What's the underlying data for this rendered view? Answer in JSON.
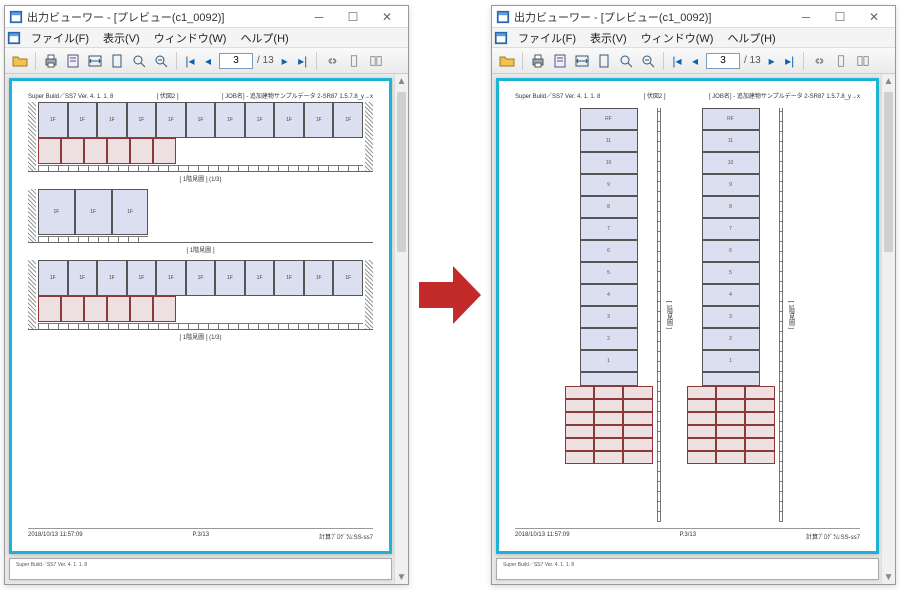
{
  "app": {
    "title_prefix": "出力ビューワー - ",
    "doc_name": "[プレビュー(c1_0092)]"
  },
  "menu": {
    "file": "ファイル(F)",
    "view": "表示(V)",
    "window": "ウィンドウ(W)",
    "help": "ヘルプ(H)"
  },
  "toolbar": {
    "page_current": "3",
    "page_total": "/ 13"
  },
  "doc": {
    "topleft": "Super Build／SS7  Ver. 4. 1. 1. 8",
    "bracket": "[ 伏図2 ]",
    "topright": "[ JOB名] - 追加建物サンプルデータ 2-SR87\n1.5.7.8_y→x",
    "labels": {
      "f1": "[ 1階見圖 ]  (1/3)",
      "f2": "[ 1階見圖 ]",
      "f3": "[ 1階見圖 ]  (1/3)",
      "ev": "[ 1階見圖 ]"
    },
    "footer_left": "2018/10/13 11:57:09",
    "footer_mid": "P.3/13",
    "footer_right": "計算ﾌﾟﾛｸﾞﾗﾑ:SS-ss7"
  },
  "colors": {
    "page_border": "#1db3d6",
    "arrow": "#c32a2a"
  }
}
